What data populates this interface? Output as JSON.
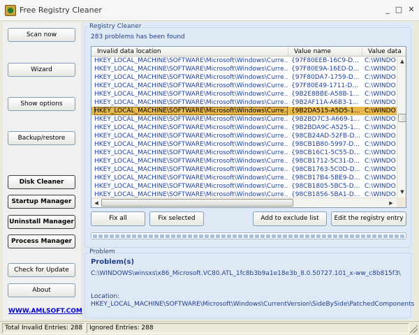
{
  "window": {
    "title": "Free Registry Cleaner",
    "minimize": "_",
    "maximize": "□",
    "close": "✕"
  },
  "sidebar": {
    "buttons": [
      {
        "label": "Scan now",
        "bold": false
      },
      {
        "label": "Wizard",
        "bold": false
      },
      {
        "label": "Show options",
        "bold": false
      },
      {
        "label": "Backup/restore",
        "bold": false
      },
      {
        "label": "Disk Cleaner",
        "bold": true
      },
      {
        "label": "Startup Manager",
        "bold": true
      },
      {
        "label": "Uninstall Manager",
        "bold": true
      },
      {
        "label": "Process Manager",
        "bold": true
      },
      {
        "label": "Check for Update",
        "bold": false
      },
      {
        "label": "About",
        "bold": false
      }
    ],
    "link": "WWW.AMLSOFT.COM"
  },
  "registry": {
    "group_label": "Registry Cleaner",
    "count_text": "283 problems has been found",
    "columns": [
      "Invalid data location",
      "Value name",
      "Value data"
    ],
    "rows": [
      {
        "location": "HKEY_LOCAL_MACHINE\\SOFTWARE\\Microsoft\\Windows\\Curre...",
        "name": "{97F80EEB-16C9-D...",
        "data": "C:\\WINDO"
      },
      {
        "location": "HKEY_LOCAL_MACHINE\\SOFTWARE\\Microsoft\\Windows\\Curre...",
        "name": "{97F80E9A-16ED-D...",
        "data": "C:\\WINDO"
      },
      {
        "location": "HKEY_LOCAL_MACHINE\\SOFTWARE\\Microsoft\\Windows\\Curre...",
        "name": "{97F80DA7-1759-D...",
        "data": "C:\\WINDO"
      },
      {
        "location": "HKEY_LOCAL_MACHINE\\SOFTWARE\\Microsoft\\Windows\\Curre...",
        "name": "{97F80E49-1711-D...",
        "data": "C:\\WINDO"
      },
      {
        "location": "HKEY_LOCAL_MACHINE\\SOFTWARE\\Microsoft\\Windows\\Curre...",
        "name": "{9B2E8BBE-A58B-1...",
        "data": "C:\\WINDO"
      },
      {
        "location": "HKEY_LOCAL_MACHINE\\SOFTWARE\\Microsoft\\Windows\\Curre...",
        "name": "{9B2AF11A-A6B3-1...",
        "data": "C:\\WINDO"
      },
      {
        "location": "HKEY_LOCAL_MACHINE\\SOFTWARE\\Microsoft\\Windows\\Curre...",
        "name": "{9B2DA515-A5D5-1...",
        "data": "C:\\WINDO",
        "selected": true
      },
      {
        "location": "HKEY_LOCAL_MACHINE\\SOFTWARE\\Microsoft\\Windows\\Curre...",
        "name": "{9B2BD7C3-A669-1...",
        "data": "C:\\WINDO"
      },
      {
        "location": "HKEY_LOCAL_MACHINE\\SOFTWARE\\Microsoft\\Windows\\Curre...",
        "name": "{9B2BDA9C-A525-1...",
        "data": "C:\\WINDO"
      },
      {
        "location": "HKEY_LOCAL_MACHINE\\SOFTWARE\\Microsoft\\Windows\\Curre...",
        "name": "{98CB24AD-52FB-D...",
        "data": "C:\\WINDO"
      },
      {
        "location": "HKEY_LOCAL_MACHINE\\SOFTWARE\\Microsoft\\Windows\\Curre...",
        "name": "{98CB1B80-5997-D...",
        "data": "C:\\WINDO"
      },
      {
        "location": "HKEY_LOCAL_MACHINE\\SOFTWARE\\Microsoft\\Windows\\Curre...",
        "name": "{98CB16C1-5C55-D...",
        "data": "C:\\WINDO"
      },
      {
        "location": "HKEY_LOCAL_MACHINE\\SOFTWARE\\Microsoft\\Windows\\Curre...",
        "name": "{98CB1712-5C31-D...",
        "data": "C:\\WINDO"
      },
      {
        "location": "HKEY_LOCAL_MACHINE\\SOFTWARE\\Microsoft\\Windows\\Curre...",
        "name": "{98CB1763-5C0D-D...",
        "data": "C:\\WINDO"
      },
      {
        "location": "HKEY_LOCAL_MACHINE\\SOFTWARE\\Microsoft\\Windows\\Curre...",
        "name": "{98CB17B4-5BE9-D...",
        "data": "C:\\WINDO"
      },
      {
        "location": "HKEY_LOCAL_MACHINE\\SOFTWARE\\Microsoft\\Windows\\Curre...",
        "name": "{98CB1805-5BC5-D...",
        "data": "C:\\WINDO"
      },
      {
        "location": "HKEY_LOCAL_MACHINE\\SOFTWARE\\Microsoft\\Windows\\Curre...",
        "name": "{98CB1856-5BA1-D...",
        "data": "C:\\WINDO"
      }
    ],
    "actions": [
      "Fix all",
      "Fix selected",
      "Add to exclude list",
      "Edit the registry entry"
    ]
  },
  "problem": {
    "group_label": "Problem",
    "title": "Problem(s)",
    "path": "C:\\WINDOWS\\winsxs\\x86_Microsoft.VC80.ATL_1fc8b3b9a1e18e3b_8.0.50727.101_x-ww_c8b815f3\\",
    "location_label": "Location:",
    "location_path": "HKEY_LOCAL_MACHINE\\SOFTWARE\\Microsoft\\Windows\\CurrentVersion\\SideBySide\\PatchedComponents"
  },
  "status": {
    "total": "Total Invalid Entries: 288",
    "ignored": "Ignored Entries: 288"
  },
  "icons": {
    "app": "shield-icon",
    "scroll_up": "arrow-up-icon",
    "scroll_down": "arrow-down-icon",
    "scroll_left": "arrow-left-icon",
    "scroll_right": "arrow-right-icon"
  },
  "colors": {
    "selection": "#e8b74a",
    "link_blue": "#1b3fa0",
    "panel_bg": "#dfe8f5"
  }
}
